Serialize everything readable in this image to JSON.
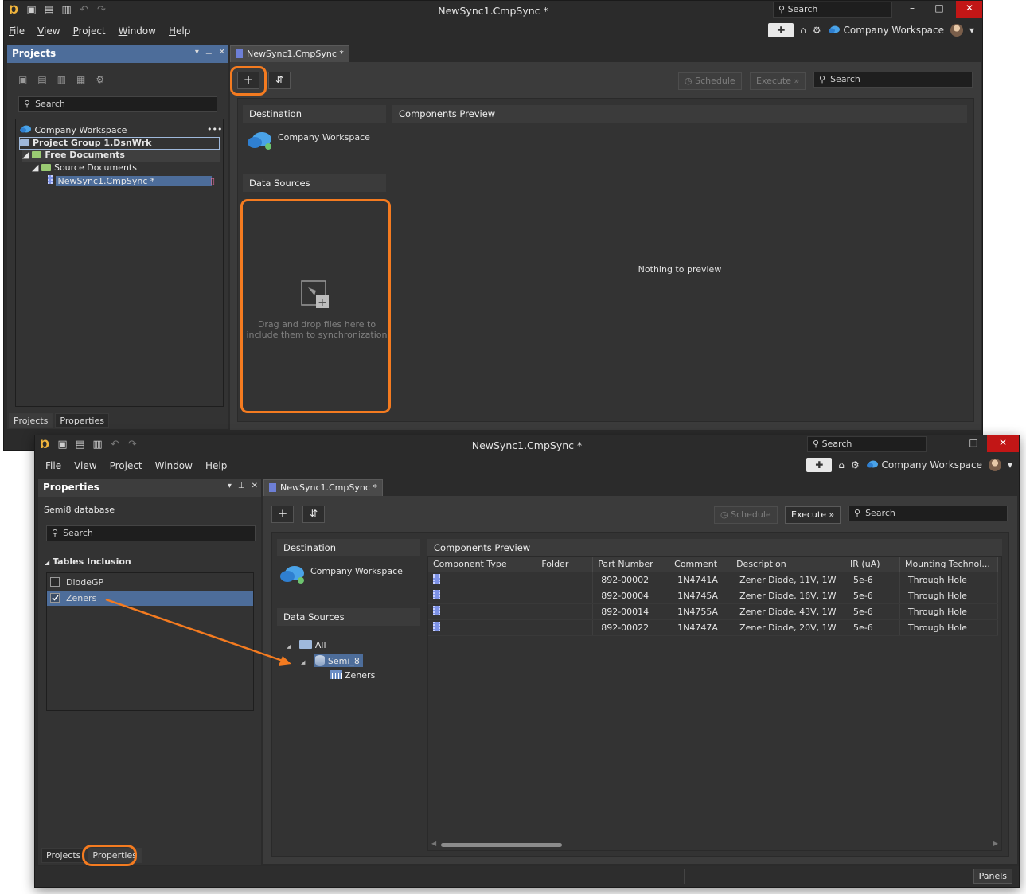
{
  "app": {
    "title": "NewSync1.CmpSync *"
  },
  "titlebar": {
    "search_placeholder": "Search",
    "minimize": "–",
    "maximize": "□",
    "close": "✕"
  },
  "menu": {
    "items": [
      "File",
      "View",
      "Project",
      "Window",
      "Help"
    ],
    "workspace": "Company Workspace"
  },
  "top": {
    "projects_panel": {
      "title": "Projects",
      "search_placeholder": "Search",
      "tree": {
        "workspace": "Company Workspace",
        "more": "•••",
        "group": "Project Group 1.DsnWrk",
        "free_docs": "Free Documents",
        "source_docs": "Source Documents",
        "file": "NewSync1.CmpSync *"
      },
      "tabs": [
        "Projects",
        "Properties"
      ]
    },
    "doc_tab": "NewSync1.CmpSync *",
    "toolbar": {
      "add": "+",
      "swap": "⇵",
      "schedule": "Schedule",
      "execute": "Execute",
      "search_placeholder": "Search"
    },
    "destination": {
      "header": "Destination",
      "name": "Company Workspace"
    },
    "data_sources": {
      "header": "Data Sources",
      "drop_hint_line1": "Drag and drop files here to",
      "drop_hint_line2": "include them to synchronization"
    },
    "preview": {
      "header": "Components Preview",
      "empty": "Nothing to preview"
    }
  },
  "bottom": {
    "properties_panel": {
      "title": "Properties",
      "subtitle": "Semi8 database",
      "search_placeholder": "Search",
      "section": "Tables Inclusion",
      "tables": [
        {
          "name": "DiodeGP",
          "checked": false
        },
        {
          "name": "Zeners",
          "checked": true
        }
      ],
      "tabs": [
        "Projects",
        "Properties"
      ]
    },
    "doc_tab": "NewSync1.CmpSync *",
    "toolbar": {
      "add": "+",
      "swap": "⇵",
      "schedule": "Schedule",
      "execute": "Execute",
      "search_placeholder": "Search"
    },
    "destination": {
      "header": "Destination",
      "name": "Company Workspace"
    },
    "data_sources": {
      "header": "Data Sources",
      "all": "All",
      "db": "Semi_8",
      "table": "Zeners"
    },
    "preview": {
      "header": "Components Preview",
      "columns": [
        "Component Type",
        "Folder",
        "Part Number",
        "Comment",
        "Description",
        "IR (uA)",
        "Mounting Technol..."
      ],
      "rows": [
        [
          "",
          "",
          "892-00002",
          "1N4741A",
          "Zener Diode, 11V, 1W",
          "5e-6",
          "Through Hole"
        ],
        [
          "",
          "",
          "892-00004",
          "1N4745A",
          "Zener Diode, 16V, 1W",
          "5e-6",
          "Through Hole"
        ],
        [
          "",
          "",
          "892-00014",
          "1N4755A",
          "Zener Diode, 43V, 1W",
          "5e-6",
          "Through Hole"
        ],
        [
          "",
          "",
          "892-00022",
          "1N4747A",
          "Zener Diode, 20V, 1W",
          "5e-6",
          "Through Hole"
        ]
      ]
    },
    "statusbar": {
      "panels": "Panels"
    }
  },
  "colors": {
    "highlight": "#f47b20",
    "selection": "#4d6d9a",
    "close": "#c21616"
  }
}
